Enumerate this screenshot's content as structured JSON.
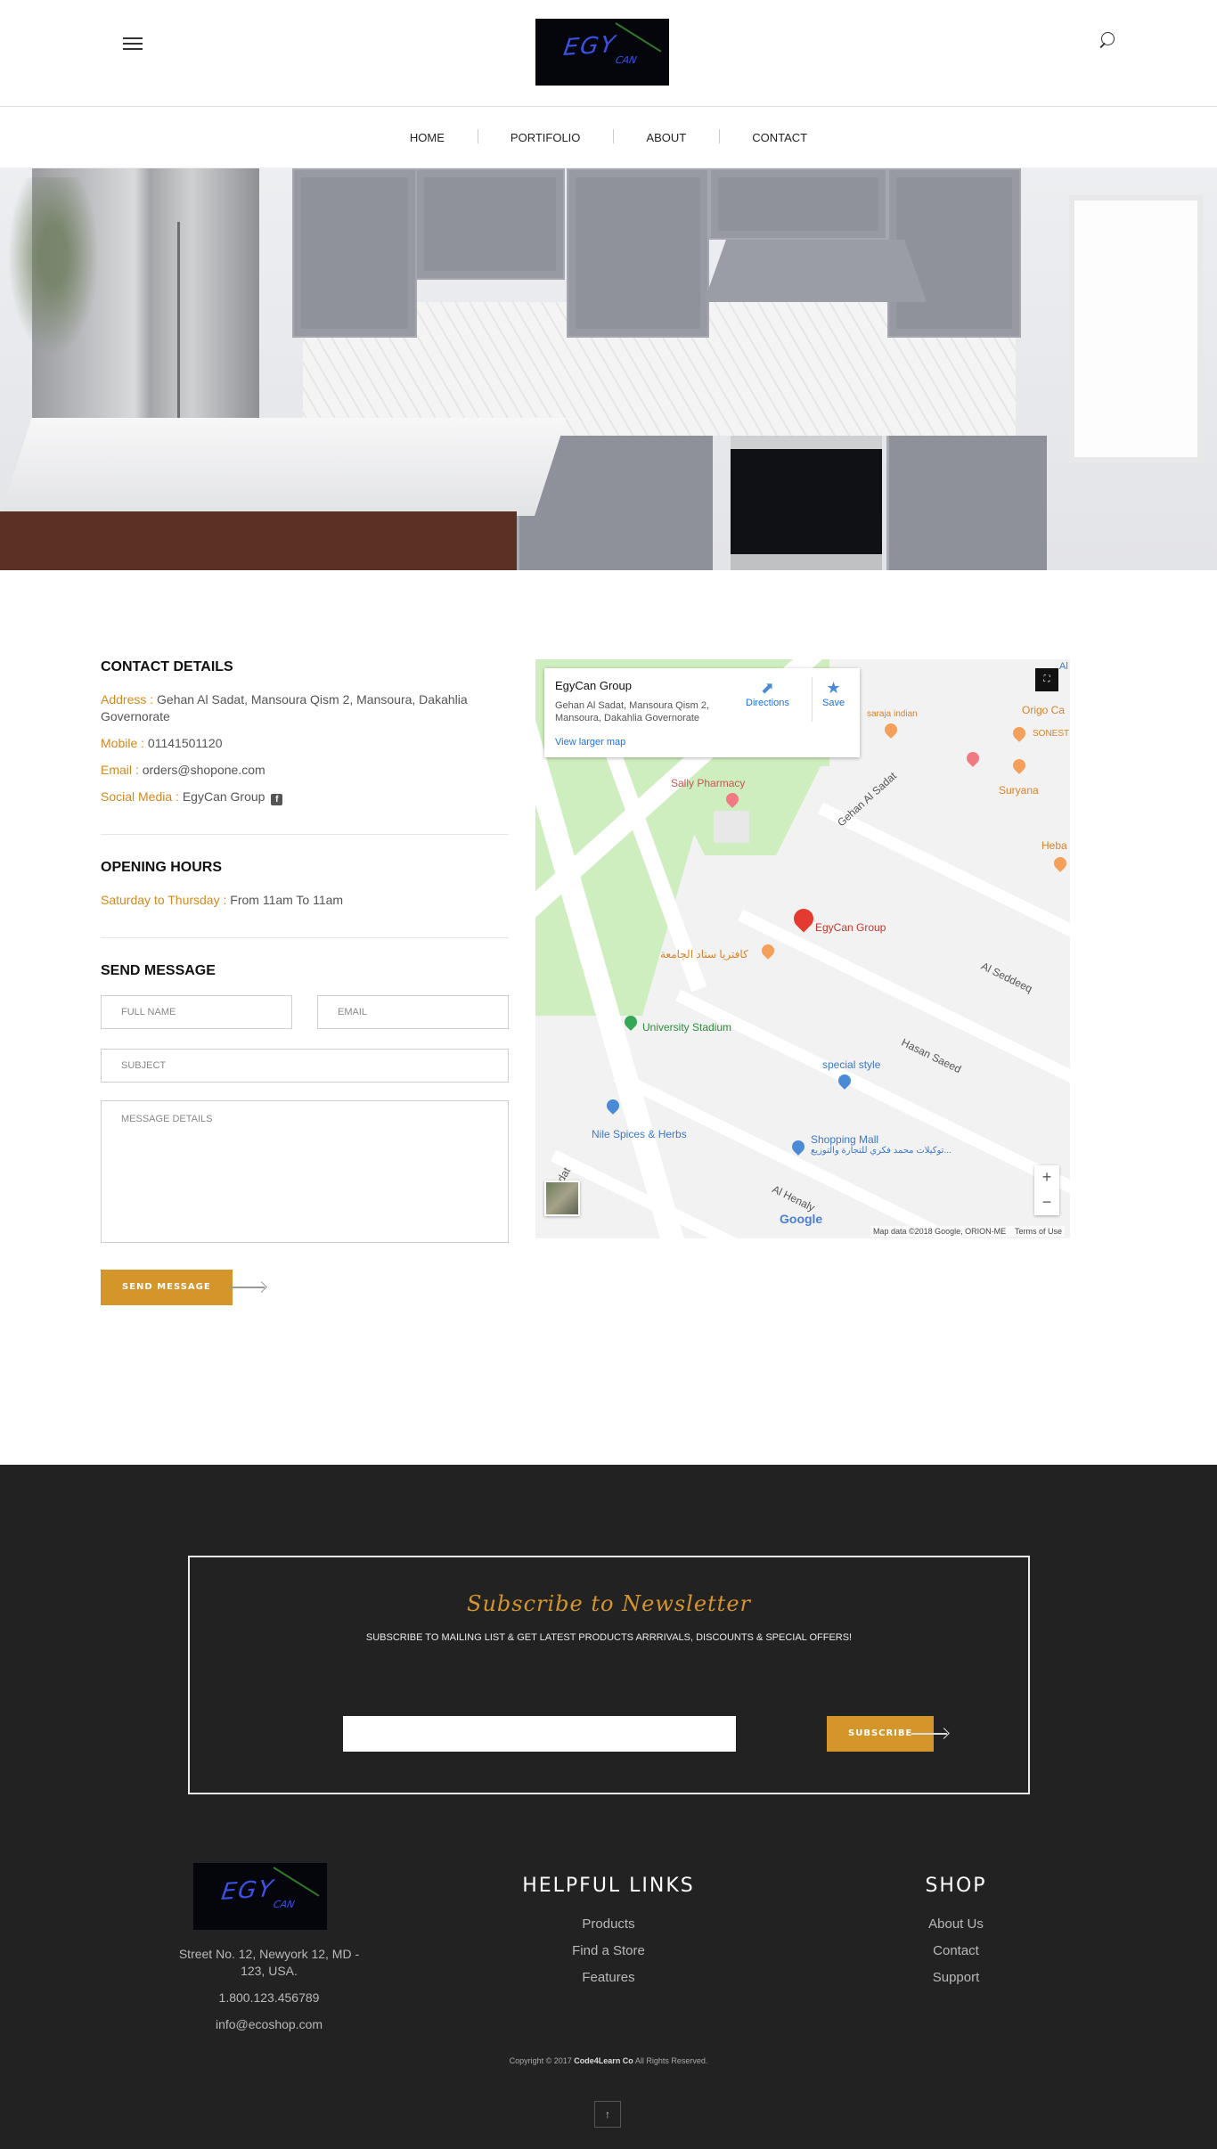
{
  "header": {
    "logo_text": "EGY",
    "logo_sub": "CAN",
    "nav": [
      "HOME",
      "PORTIFOLIO",
      "ABOUT",
      "CONTACT"
    ]
  },
  "contact": {
    "details_title": "CONTACT DETAILS",
    "address_label": "Address :",
    "address": "Gehan Al Sadat, Mansoura Qism 2, Mansoura, Dakahlia Governorate",
    "mobile_label": "Mobile :",
    "mobile": "01141501120",
    "email_label": "Email :",
    "email": "orders@shopone.com",
    "social_label": "Social Media :",
    "social": "EgyCan Group",
    "hours_title": "OPENING HOURS",
    "hours_label": "Saturday to Thursday :",
    "hours": "From 11am To 11am",
    "send_title": "SEND MESSAGE",
    "fullname_placeholder": "FULL NAME",
    "email_placeholder": "EMAIL",
    "subject_placeholder": "SUBJECT",
    "message_placeholder": "MESSAGE DETAILS",
    "send_button": "SEND MESSAGE"
  },
  "map": {
    "place_name": "EgyCan Group",
    "place_address": "Gehan Al Sadat, Mansoura Qism 2, Mansoura, Dakahlia Governorate",
    "directions": "Directions",
    "save": "Save",
    "larger_map": "View larger map",
    "labels": {
      "sally": "Sally Pharmacy",
      "gehan": "Gehan Al Sadat",
      "egycan": "EgyCan Group",
      "arabic_cafe": "كافتريا ستاد الجامعة",
      "seddeeq": "Al Seddeeq",
      "stadium": "University Stadium",
      "hasan": "Hasan Saeed",
      "special": "special style",
      "nile": "Nile Spices & Herbs",
      "mall": "Shopping Mall",
      "mall_ar": "توكيلات محمد فكري للتجارة والتوزيع...",
      "henaly": "Al Henaly",
      "sadat_left": "Al Sadat",
      "origo": "Origo Ca",
      "sonesta": "SONEST",
      "suryana": "Suryana",
      "heba": "Heba",
      "saraja": "saraja indian",
      "al_top": "Al"
    },
    "footer_text": "Map data ©2018 Google, ORION-ME",
    "terms": "Terms of Use",
    "google": "Google"
  },
  "newsletter": {
    "title": "Subscribe to Newsletter",
    "subtitle": "SUBSCRIBE TO MAILING LIST & GET LATEST PRODUCTS ARRRIVALS, DISCOUNTS & SPECIAL OFFERS!",
    "button": "SUBSCRIBE"
  },
  "footer": {
    "address": "Street No. 12, Newyork 12, MD - 123, USA.",
    "phone": "1.800.123.456789",
    "email": "info@ecoshop.com",
    "helpful_title": "HELPFUL LINKS",
    "helpful_links": [
      "Products",
      "Find a Store",
      "Features"
    ],
    "shop_title": "SHOP",
    "shop_links": [
      "About Us",
      "Contact",
      "Support"
    ],
    "copyright_pre": "Copyright © 2017",
    "copyright_brand": "Code4Learn Co",
    "copyright_post": "All Rights Reserved.",
    "to_top": "↑"
  },
  "colors": {
    "accent": "#d4952b",
    "footer_bg": "#222222",
    "map_green": "#cfeebf",
    "pin_red": "#e53a2f"
  }
}
